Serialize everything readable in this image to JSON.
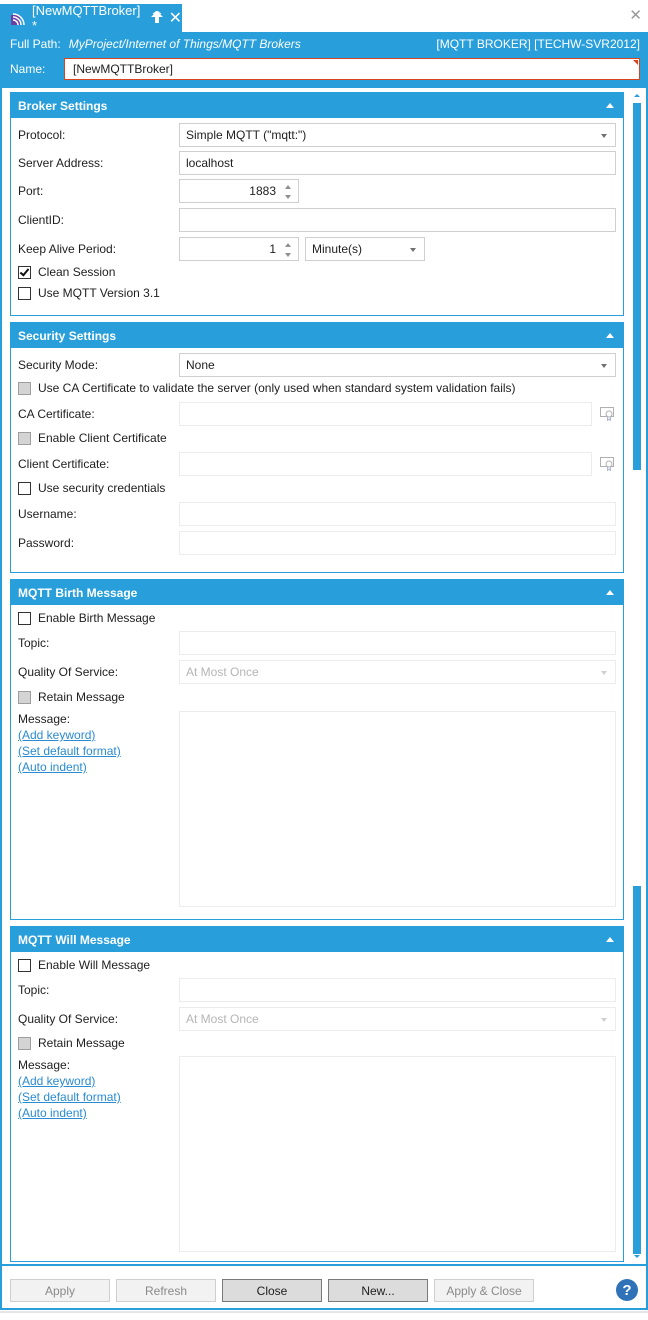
{
  "tab": {
    "icon": "rss-broadcast-icon",
    "title": "[NewMQTTBroker] *",
    "pin_icon": "pin-up-arrow-icon",
    "close_icon": "close-icon"
  },
  "window": {
    "close_icon": "close-icon",
    "close_glyph": "✕"
  },
  "header": {
    "full_path_label": "Full Path:",
    "full_path_value": "MyProject/Internet of Things/MQTT Brokers",
    "meta": "[MQTT BROKER] [TECHW-SVR2012]",
    "name_label": "Name:",
    "name_value": "[NewMQTTBroker]"
  },
  "colors": {
    "accent": "#289fdb",
    "error": "#d9431e",
    "link": "#2a8bd2",
    "help": "#2f72b7"
  },
  "broker": {
    "title": "Broker Settings",
    "protocol_label": "Protocol:",
    "protocol_value": "Simple MQTT (\"mqtt:\")",
    "server_label": "Server Address:",
    "server_value": "localhost",
    "port_label": "Port:",
    "port_value": "1883",
    "clientid_label": "ClientID:",
    "clientid_value": "",
    "keepalive_label": "Keep Alive Period:",
    "keepalive_value": "1",
    "keepalive_unit": "Minute(s)",
    "clean_session_label": "Clean Session",
    "clean_session_checked": true,
    "mqtt31_label": "Use MQTT Version 3.1",
    "mqtt31_checked": false
  },
  "security": {
    "title": "Security Settings",
    "mode_label": "Security Mode:",
    "mode_value": "None",
    "use_ca_label": "Use CA Certificate to validate the server (only used when standard system validation fails)",
    "ca_cert_label": "CA Certificate:",
    "ca_cert_value": "",
    "enable_client_cert_label": "Enable Client Certificate",
    "client_cert_label": "Client Certificate:",
    "client_cert_value": "",
    "use_credentials_label": "Use security credentials",
    "username_label": "Username:",
    "username_value": "",
    "password_label": "Password:",
    "password_value": ""
  },
  "birth": {
    "title": "MQTT Birth Message",
    "enable_label": "Enable Birth Message",
    "topic_label": "Topic:",
    "topic_value": "",
    "qos_label": "Quality Of Service:",
    "qos_value": "At Most Once",
    "retain_label": "Retain Message",
    "message_label": "Message:",
    "links": [
      "(Add keyword)",
      "(Set default format)",
      "(Auto indent)"
    ]
  },
  "will": {
    "title": "MQTT Will Message",
    "enable_label": "Enable Will Message",
    "topic_label": "Topic:",
    "topic_value": "",
    "qos_label": "Quality Of Service:",
    "qos_value": "At Most Once",
    "retain_label": "Retain Message",
    "message_label": "Message:",
    "links": [
      "(Add keyword)",
      "(Set default format)",
      "(Auto indent)"
    ]
  },
  "footer": {
    "apply": "Apply",
    "refresh": "Refresh",
    "close": "Close",
    "new": "New...",
    "apply_close": "Apply & Close",
    "help": "?"
  }
}
